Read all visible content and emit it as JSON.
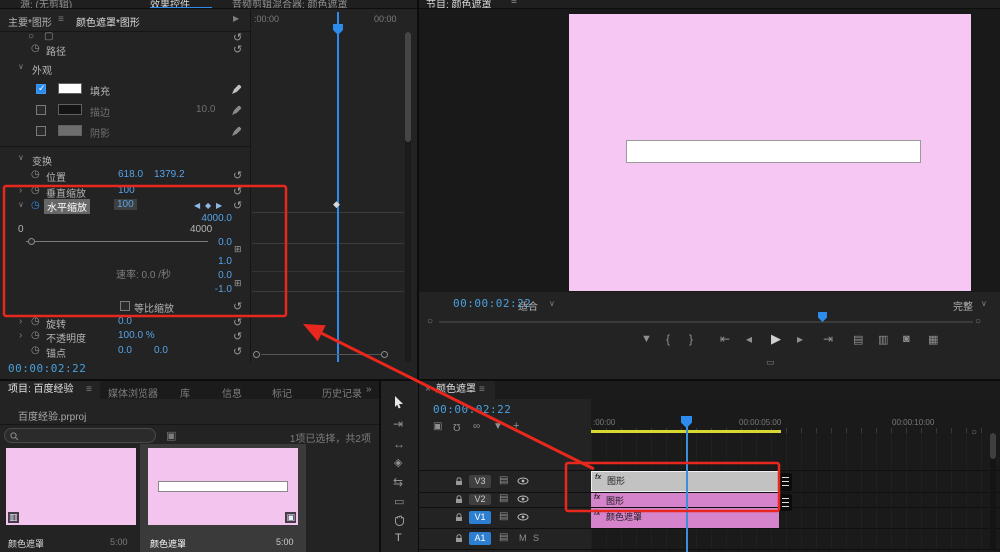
{
  "icons": {
    "menu": "≡",
    "chevron_down": "∨",
    "chevron_right": "›",
    "stopwatch": "◷",
    "reset": "↺",
    "check": "✓",
    "nav_prev": "◀",
    "nav_add": "◆",
    "nav_next": "▶",
    "keyframe": "◆",
    "collapse_arrow": "▶",
    "circle_shape": "○",
    "square_shape": "▢",
    "graph_expand": "⊞",
    "marker": "▼",
    "mark_in": "{",
    "mark_out": "}",
    "go_in": "⇤",
    "step_back": "◂",
    "play": "▶",
    "step_fwd": "▸",
    "go_out": "⇥",
    "lift": "▤",
    "extract": "▥",
    "export_frame": "◙",
    "compare": "▦",
    "button_editor": "▭",
    "overflow": "»",
    "close": "×",
    "grid_view": "▣",
    "patch": "▤",
    "badge_media": "▥",
    "badge_sequence": "▣",
    "tool_track_select": "⇥",
    "tool_ripple": "↔",
    "tool_razor": "◈",
    "tool_slip": "⇆",
    "tool_rect": "▭",
    "tool_type": "T",
    "tl_nest": "▣",
    "tl_snap": "Ω",
    "tl_link": "∞",
    "tl_marker": "▼",
    "tl_settings": "+",
    "zoom_dot": "○",
    "mute": "M",
    "solo": "S"
  },
  "effect_controls": {
    "tabs": {
      "left": "源: (无剪辑)",
      "active": "效果控件",
      "right": "音频剪辑混合器: 颜色遮罩"
    },
    "master": "主要*图形",
    "clip": "颜色遮罩*图形",
    "ruler": {
      "start": ":00:00",
      "end": "00:00"
    },
    "props": {
      "path": "路径",
      "appearance": "外观",
      "fill": "填充",
      "stroke": "描边",
      "stroke_width": "10.0",
      "shadow": "阴影",
      "transform": "变换",
      "position": "位置",
      "position_x": "618.0",
      "position_y": "1379.2",
      "v_scale": "垂直缩放",
      "v_scale_value": "100",
      "h_scale": "水平缩放",
      "h_scale_value": "100",
      "slider_min": "0",
      "slider_max": "4000",
      "graph_max": "4000.0",
      "graph_min": "0.0",
      "vel_max": "1.0",
      "vel_mid": "0.0",
      "vel_min": "-1.0",
      "rate": "速率: 0.0 /秒",
      "uniform": "等比缩放",
      "rotation": "旋转",
      "rotation_value": "0.0",
      "opacity": "不透明度",
      "opacity_value": "100.0 %",
      "anchor": "锚点",
      "anchor_x": "0.0",
      "anchor_y": "0.0"
    },
    "timecode": "00:00:02:22"
  },
  "program_monitor": {
    "tab": "节目: 颜色遮罩",
    "timecode": "00:00:02:22",
    "zoom": "适合",
    "resolution": "完整"
  },
  "project": {
    "tabs": {
      "project": "项目: 百度经验",
      "media": "媒体浏览器",
      "libraries": "库",
      "info": "信息",
      "markers": "标记",
      "history": "历史记录"
    },
    "file": "百度经验.prproj",
    "selection": "1项已选择，共2项",
    "items": [
      {
        "name": "颜色遮罩",
        "duration": "5:00"
      },
      {
        "name": "颜色遮罩",
        "duration": "5:00"
      }
    ]
  },
  "timeline": {
    "tab": "颜色遮罩",
    "timecode": "00:00:02:22",
    "ruler": {
      "t0": ":00:00",
      "t1": "00:00:05:00",
      "t2": "00:00:10:00"
    },
    "tracks": {
      "v3": "V3",
      "v2": "V2",
      "v1": "V1",
      "a1": "A1"
    },
    "clips": {
      "v3": "图形",
      "v2": "图形",
      "v1": "颜色遮罩"
    },
    "fx": "fx"
  },
  "colors": {
    "accent_blue": "#2d8ceb",
    "value_blue": "#55a3e8",
    "timecode_blue": "#49a0dc",
    "monitor_pink": "#f7c7f3",
    "clip_pink": "#d583cb",
    "selected_clip_gray": "#c2c2c2",
    "render_bar_yellow": "#d8d832",
    "annotation_red": "#e8281e"
  }
}
